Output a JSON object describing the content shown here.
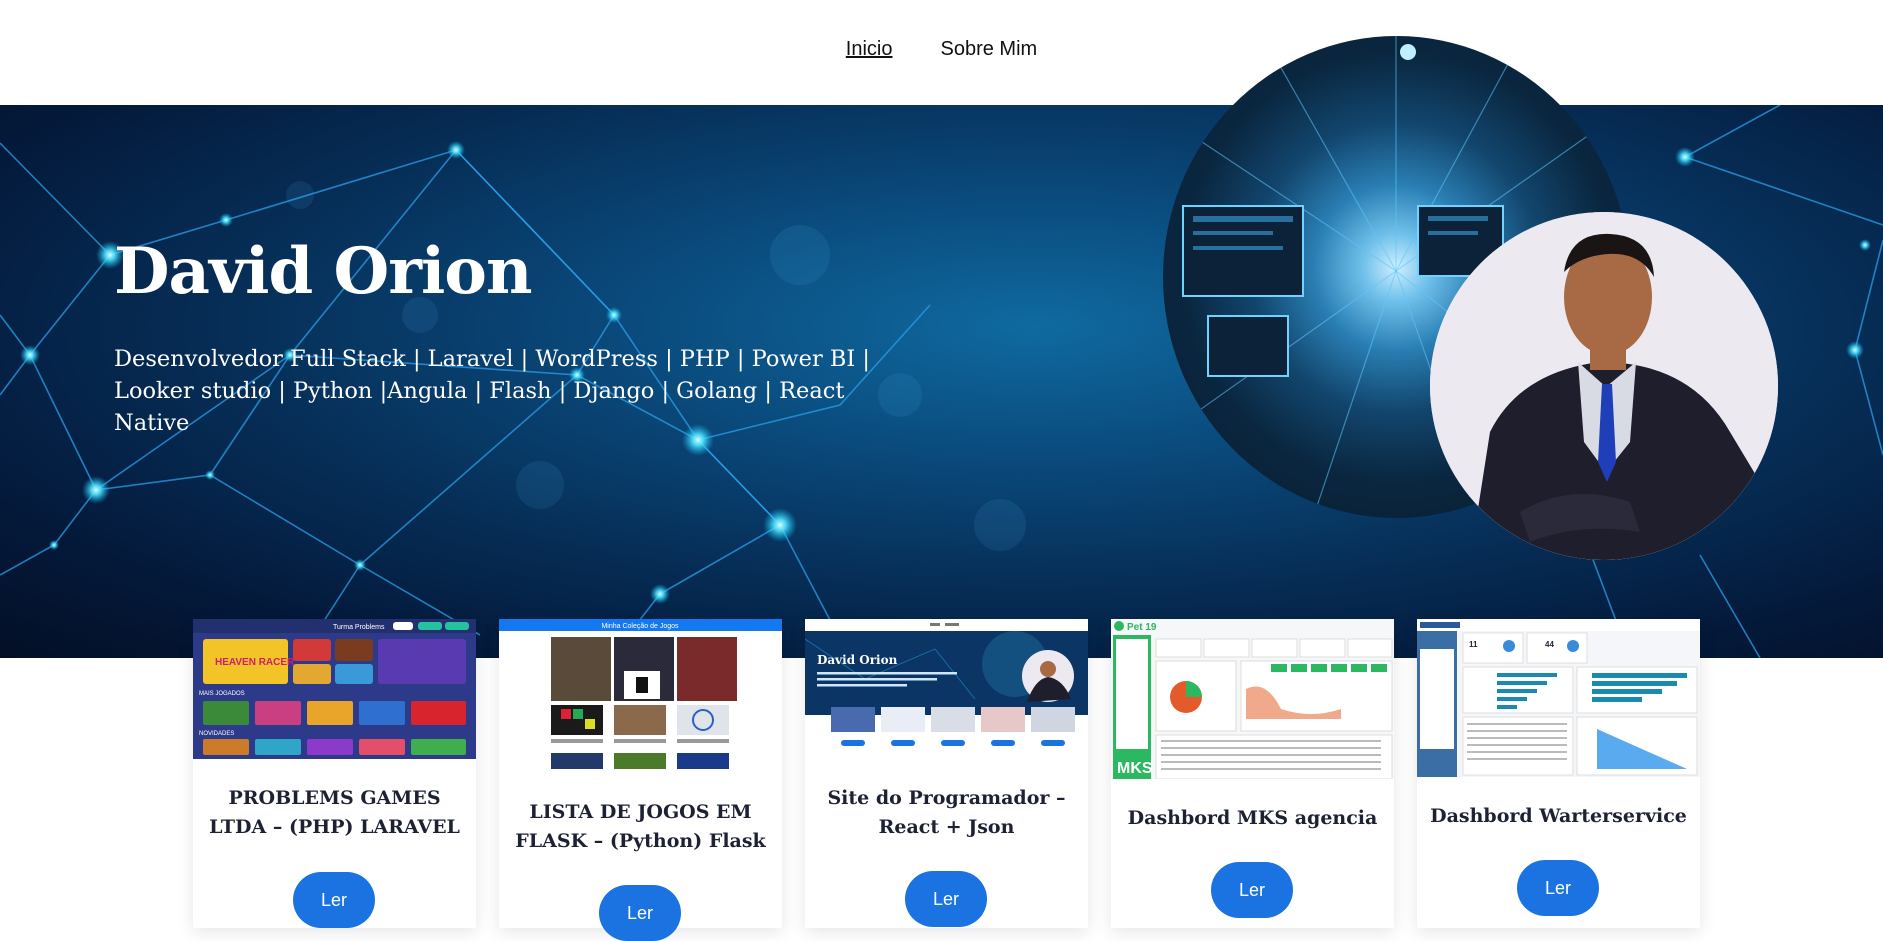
{
  "nav": {
    "items": [
      {
        "label": "Inicio",
        "active": true
      },
      {
        "label": "Sobre Mim",
        "active": false
      }
    ]
  },
  "hero": {
    "title": "David Orion",
    "subtitle": "Desenvolvedor Full Stack | Laravel | WordPress | PHP | Power BI | Looker studio | Python |Angula | Flash | Django | Golang | React Native"
  },
  "colors": {
    "accent": "#1a73e0",
    "hero_dark": "#04193a",
    "card_title": "#1d2233"
  },
  "thumbs": {
    "problems": {
      "logo": "Turma Problems",
      "banner": "HEAVEN RACER",
      "section1": "MAIS JOGADOS",
      "section2": "NOVIDADES"
    },
    "flask": {
      "header": "Minha Coleção de Jogos"
    },
    "site": {
      "title": "David Orion"
    },
    "mks": {
      "logo": "Pet 19",
      "brand": "MKS"
    }
  },
  "cards": [
    {
      "title": "PROBLEMS GAMES LTDA – (PHP) LARAVEL",
      "button": "Ler"
    },
    {
      "title": "LISTA DE JOGOS EM FLASK – (Python) Flask",
      "button": "Ler"
    },
    {
      "title": "Site do Programador – React + Json",
      "button": "Ler"
    },
    {
      "title": "Dashbord MKS agencia",
      "button": "Ler"
    },
    {
      "title": "Dashbord Warterservice",
      "button": "Ler"
    }
  ]
}
